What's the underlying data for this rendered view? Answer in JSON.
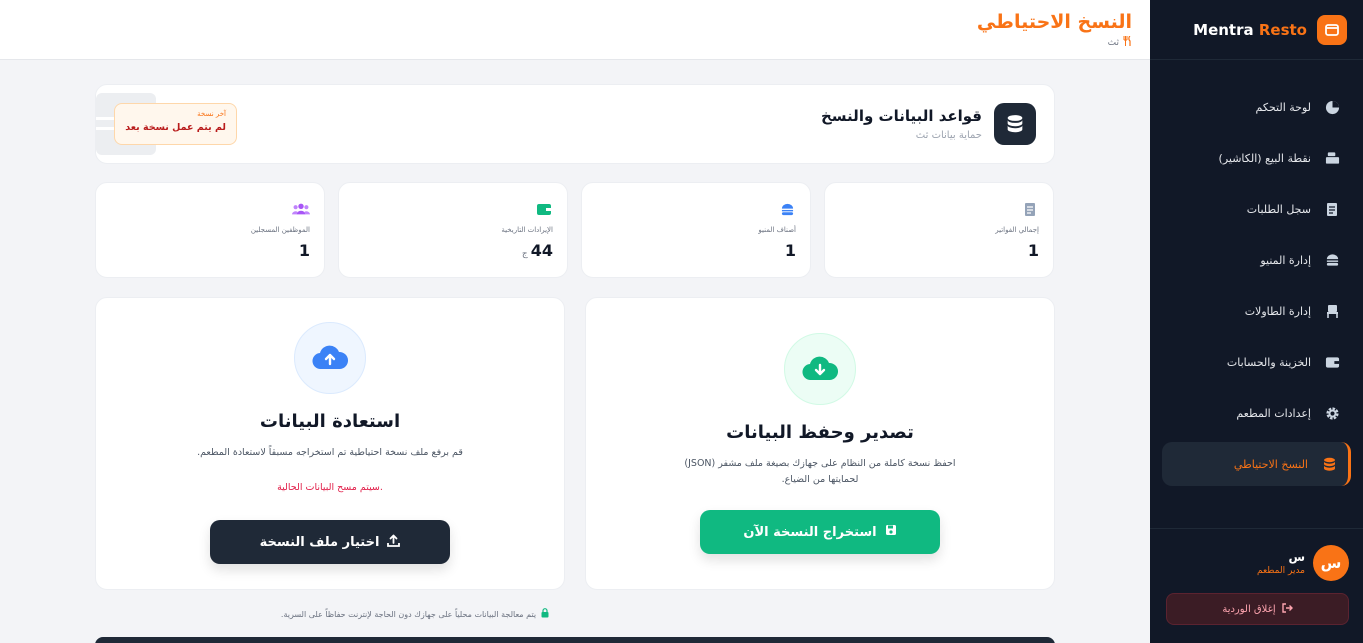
{
  "brand": {
    "name_part1": "Mentra",
    "name_part2": "Resto"
  },
  "sidebar": {
    "items": [
      {
        "label": "لوحة التحكم",
        "icon": "pie-chart-icon"
      },
      {
        "label": "نقطة البيع (الكاشير)",
        "icon": "cash-register-icon"
      },
      {
        "label": "سجل الطلبات",
        "icon": "receipt-icon"
      },
      {
        "label": "إدارة المنيو",
        "icon": "burger-icon"
      },
      {
        "label": "إدارة الطاولات",
        "icon": "chair-icon"
      },
      {
        "label": "الخزينة والحسابات",
        "icon": "wallet-icon"
      },
      {
        "label": "إعدادات المطعم",
        "icon": "gear-icon"
      },
      {
        "label": "النسخ الاحتياطي",
        "icon": "database-icon",
        "active": true
      }
    ],
    "user": {
      "initial": "س",
      "name": "س",
      "role": "مدير المطعم"
    },
    "logout_label": "إغلاق الوردية"
  },
  "header": {
    "title": "النسخ الاحتياطي",
    "subtitle": "ثث"
  },
  "db_card": {
    "title": "قواعد البيانات والنسخ",
    "subtitle": "حماية بيانات ثث",
    "last_backup_label": "آخر نسخة",
    "last_backup_value": "لم يتم عمل نسخة بعد"
  },
  "stats": [
    {
      "label": "إجمالي الفواتير",
      "value": "1",
      "icon": "invoice-icon",
      "color": "#94a3b8"
    },
    {
      "label": "أصناف المنيو",
      "value": "1",
      "icon": "burger-icon",
      "color": "#3b82f6"
    },
    {
      "label": "الإيرادات التاريخية",
      "value": "44",
      "unit": "ج",
      "icon": "wallet-icon",
      "color": "#10b981"
    },
    {
      "label": "الموظفين المسجلين",
      "value": "1",
      "icon": "users-icon",
      "color": "#a855f7"
    }
  ],
  "export": {
    "title": "تصدير وحفظ البيانات",
    "desc": "احفظ نسخة كاملة من النظام على جهازك بصيغة ملف مشفر (JSON) لحمايتها من الضياع.",
    "button": "استخراج النسخة الآن",
    "color": "#10b981"
  },
  "restore": {
    "title": "استعادة البيانات",
    "desc": "قم برفع ملف نسخة احتياطية تم استخراجه مسبقاً لاستعادة المطعم.",
    "warning": "سيتم مسح البيانات الحالية.",
    "button": "اختيار ملف النسخة",
    "color": "#1f2937"
  },
  "footer_note": "يتم معالجة البيانات محلياً على جهازك دون الحاجة لإنترنت حفاظاً على السرية.",
  "colors": {
    "accent": "#f97316",
    "sidebar_bg": "#111827",
    "success": "#10b981",
    "danger": "#e11d48"
  }
}
